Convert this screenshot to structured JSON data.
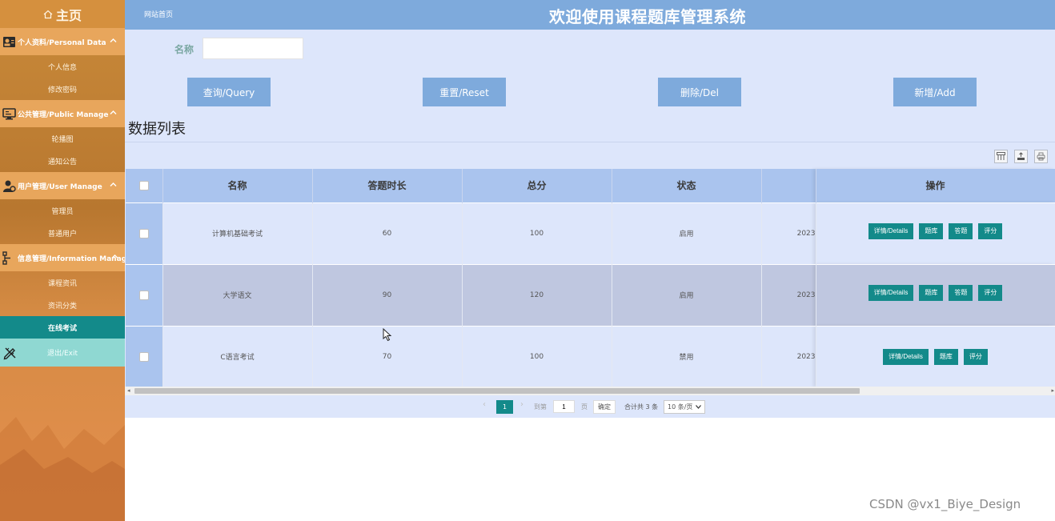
{
  "sidebar": {
    "home_label": "主页",
    "sections": [
      {
        "title": "个人资料/Personal Data",
        "icon": "user-card-icon",
        "items": [
          "个人信息",
          "修改密码"
        ]
      },
      {
        "title": "公共管理/Public Manage",
        "icon": "monitor-icon",
        "items": [
          "轮播图",
          "通知公告"
        ]
      },
      {
        "title": "用户管理/User Manage",
        "icon": "user-gear-icon",
        "items": [
          "管理员",
          "普通用户"
        ]
      },
      {
        "title": "信息管理/Information Manage",
        "icon": "sitemap-icon",
        "items": [
          "课程资讯",
          "资讯分类",
          "在线考试"
        ]
      }
    ],
    "active_item": "在线考试",
    "exit_label": "退出/Exit"
  },
  "header": {
    "breadcrumb": "网站首页",
    "title": "欢迎使用课程题库管理系统"
  },
  "search": {
    "name_label": "名称",
    "name_value": "",
    "buttons": {
      "query": "查询/Query",
      "reset": "重置/Reset",
      "delete": "删除/Del",
      "add": "新增/Add"
    }
  },
  "list_title": "数据列表",
  "table": {
    "columns": [
      "名称",
      "答题时长",
      "总分",
      "状态",
      "",
      "操作"
    ],
    "rows": [
      {
        "name": "计算机基础考试",
        "duration": "60",
        "score": "100",
        "status": "启用",
        "date": "2023",
        "ops": [
          "详情/Details",
          "题库",
          "答题",
          "评分"
        ]
      },
      {
        "name": "大学语文",
        "duration": "90",
        "score": "120",
        "status": "启用",
        "date": "2023",
        "ops": [
          "详情/Details",
          "题库",
          "答题",
          "评分"
        ]
      },
      {
        "name": "C语言考试",
        "duration": "70",
        "score": "100",
        "status": "禁用",
        "date": "2023",
        "ops": [
          "详情/Details",
          "题库",
          "评分"
        ]
      }
    ]
  },
  "pagination": {
    "current_page": "1",
    "goto_label": "到第",
    "goto_value": "1",
    "page_unit": "页",
    "confirm": "确定",
    "total": "合计共 3 条",
    "page_size": "10 条/页"
  },
  "watermark": "CSDN @vx1_Biye_Design",
  "colors": {
    "topbar": "#7eaadc",
    "accent": "#138a8a",
    "panel": "#dde6fb",
    "sidebar": "#c98a3a"
  }
}
